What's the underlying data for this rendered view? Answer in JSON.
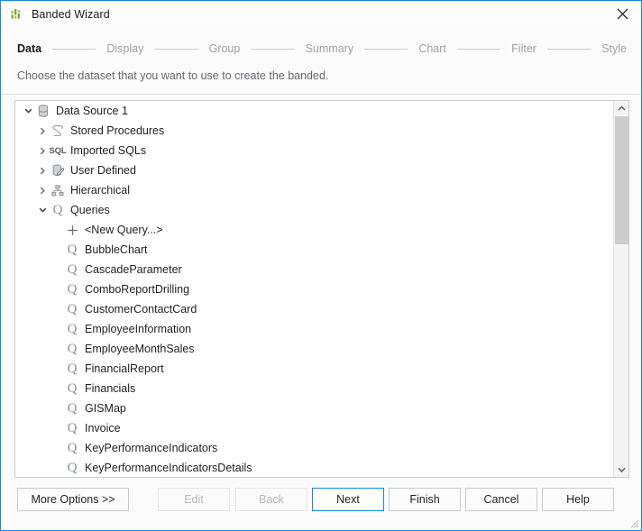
{
  "window": {
    "title": "Banded Wizard",
    "app_icon": "bar-chart-icon",
    "close_icon": "close-icon",
    "accent_color": "#1b8ad4"
  },
  "steps": [
    {
      "label": "Data",
      "active": true
    },
    {
      "label": "Display",
      "active": false
    },
    {
      "label": "Group",
      "active": false
    },
    {
      "label": "Summary",
      "active": false
    },
    {
      "label": "Chart",
      "active": false
    },
    {
      "label": "Filter",
      "active": false
    },
    {
      "label": "Style",
      "active": false
    }
  ],
  "subtitle": "Choose the dataset that you want to use to create the banded.",
  "tree": {
    "rows": [
      {
        "label": "Data Source 1",
        "indent": 0,
        "expander": "chevron-down-icon",
        "icon": "database-icon"
      },
      {
        "label": "Stored Procedures",
        "indent": 1,
        "expander": "chevron-right-icon",
        "icon": "stored-procedure-icon"
      },
      {
        "label": "Imported SQLs",
        "indent": 1,
        "expander": "chevron-right-icon",
        "icon": "sql-icon"
      },
      {
        "label": "User Defined",
        "indent": 1,
        "expander": "chevron-right-icon",
        "icon": "user-defined-icon"
      },
      {
        "label": "Hierarchical",
        "indent": 1,
        "expander": "chevron-right-icon",
        "icon": "hierarchical-icon"
      },
      {
        "label": "Queries",
        "indent": 1,
        "expander": "chevron-down-icon",
        "icon": "query-icon"
      },
      {
        "label": "<New Query...>",
        "indent": 2,
        "expander": "none",
        "icon": "plus-icon"
      },
      {
        "label": "BubbleChart",
        "indent": 2,
        "expander": "none",
        "icon": "query-icon"
      },
      {
        "label": "CascadeParameter",
        "indent": 2,
        "expander": "none",
        "icon": "query-icon"
      },
      {
        "label": "ComboReportDrilling",
        "indent": 2,
        "expander": "none",
        "icon": "query-icon"
      },
      {
        "label": "CustomerContactCard",
        "indent": 2,
        "expander": "none",
        "icon": "query-icon"
      },
      {
        "label": "EmployeeInformation",
        "indent": 2,
        "expander": "none",
        "icon": "query-icon"
      },
      {
        "label": "EmployeeMonthSales",
        "indent": 2,
        "expander": "none",
        "icon": "query-icon"
      },
      {
        "label": "FinancialReport",
        "indent": 2,
        "expander": "none",
        "icon": "query-icon"
      },
      {
        "label": "Financials",
        "indent": 2,
        "expander": "none",
        "icon": "query-icon"
      },
      {
        "label": "GISMap",
        "indent": 2,
        "expander": "none",
        "icon": "query-icon"
      },
      {
        "label": "Invoice",
        "indent": 2,
        "expander": "none",
        "icon": "query-icon"
      },
      {
        "label": "KeyPerformanceIndicators",
        "indent": 2,
        "expander": "none",
        "icon": "query-icon"
      },
      {
        "label": "KeyPerformanceIndicatorsDetails",
        "indent": 2,
        "expander": "none",
        "icon": "query-icon"
      }
    ]
  },
  "scrollbar": {
    "up_icon": "chevron-up-icon",
    "down_icon": "chevron-down-icon"
  },
  "buttons": {
    "more_options": "More Options >>",
    "edit": "Edit",
    "back": "Back",
    "next": "Next",
    "finish": "Finish",
    "cancel": "Cancel",
    "help": "Help"
  }
}
